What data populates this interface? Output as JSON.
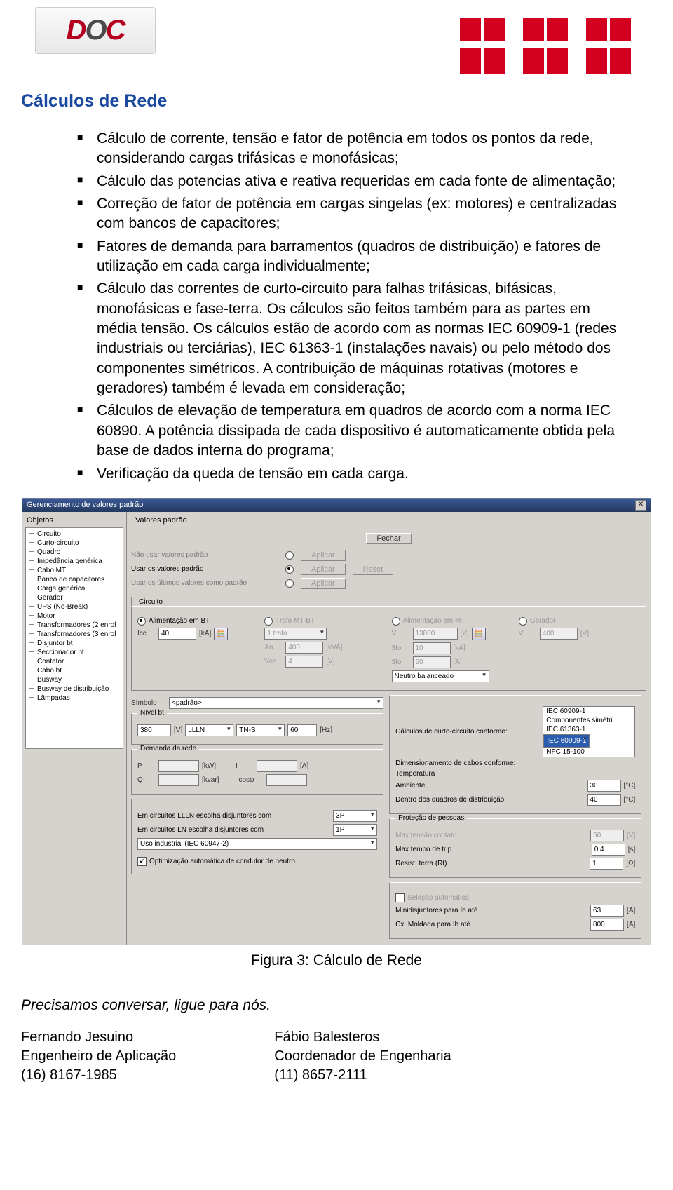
{
  "header": {
    "doc_logo_text": "DOC",
    "abb_logo_alt": "ABB"
  },
  "section_title": "Cálculos de Rede",
  "bullets": [
    "Cálculo de corrente, tensão e fator de potência em todos os pontos da rede, considerando cargas trifásicas e monofásicas;",
    "Cálculo das potencias ativa e reativa requeridas em cada fonte de alimentação;",
    "Correção de fator de potência em cargas singelas (ex: motores) e centralizadas com bancos de capacitores;",
    "Fatores de demanda para barramentos (quadros de distribuição) e fatores de utilização em cada carga individualmente;",
    "Cálculo das correntes de curto-circuito para falhas trifásicas, bifásicas, monofásicas e fase-terra. Os cálculos são feitos também para as partes em média tensão. Os cálculos estão de acordo com as normas IEC 60909-1 (redes industriais ou terciárias), IEC 61363-1 (instalações navais) ou pelo método dos componentes simétricos. A contribuição de máquinas rotativas (motores e geradores) também é levada em consideração;",
    "Cálculos de elevação de temperatura em quadros de acordo com a norma IEC 60890. A potência dissipada de cada dispositivo é automaticamente obtida pela base de dados interna do programa;",
    "Verificação da queda de tensão em cada carga."
  ],
  "dialog": {
    "title": "Gerenciamento de valores padrão",
    "close_label": "Fechar",
    "objects_header": "Objetos",
    "values_header": "Valores padrão",
    "tree_items": [
      "Circuito",
      "Curto-circuito",
      "Quadro",
      "Impedância genérica",
      "Cabo MT",
      "Banco de capacitores",
      "Carga genérica",
      "Gerador",
      "UPS (No-Break)",
      "Motor",
      "Transformadores (2 enrol",
      "Transformadores (3 enrol",
      "Disjuntor bt",
      "Seccionador bt",
      "Contator",
      "Cabo bt",
      "Busway",
      "Busway de distribuição",
      "Lâmpadas"
    ],
    "radio_options": {
      "opt1": "Não usar valores padrão",
      "opt2": "Usar os valores padrão",
      "opt3": "Usar os últimos valores como padrão"
    },
    "apply_label": "Aplicar",
    "reset_label": "Reset",
    "circuit_tab": "Circuito",
    "supply_modes": {
      "bt": "Alimentação em BT",
      "trafo": "Trafo MT-BT",
      "mt": "Alimentação em MT",
      "ger": "Gerador"
    },
    "fields": {
      "icc_label": "Icc",
      "icc_val": "40",
      "icc_unit": "[kA]",
      "trafo_sel": "1 trafo",
      "an_label": "An",
      "an_val": "400",
      "an_unit": "[kVA]",
      "vcc_label": "Vcc",
      "vcc_val": "4",
      "vcc_unit": "[V]",
      "v_label": "V",
      "v_val": "13800",
      "v_unit": "[V]",
      "tlo_label": "3Io",
      "tlo_val": "10",
      "tlo_unit": "[kA]",
      "slo_label": "3Io",
      "slo_val": "50",
      "slo_unit": "[A]",
      "neutro": "Neutro balanceado",
      "ger_v_label": "V",
      "ger_v_val": "400",
      "ger_v_unit": "[V]"
    },
    "simbolo_label": "Símbolo",
    "simbolo_val": "<padrão>",
    "nivel_legend": "Nível bt",
    "nivel_v": "380",
    "nivel_v_unit": "[V]",
    "nivel_llln": "LLLN",
    "nivel_tns": "TN-S",
    "nivel_hz": "60",
    "nivel_hz_unit": "[Hz]",
    "demanda_legend": "Demanda da rede",
    "p_label": "P",
    "p_unit": "[kW]",
    "q_label": "Q",
    "q_unit": "[kvar]",
    "i_label": "I",
    "i_unit": "[A]",
    "cosphi_label": "cosφ",
    "llln_label": "Em circuitos LLLN escolha disjuntores com",
    "llln_val": "3P",
    "ln_label": "Em circuitos LN escolha disjuntores com",
    "ln_val": "1P",
    "uso_val": "Uso industrial (IEC 60947-2)",
    "opt_neutro": "Optimização automática de condutor de neutro",
    "cc_conf_label": "Cálculos de curto-circuito conforme:",
    "cc_list": [
      "IEC 60909-1",
      "Componentes simétri",
      "IEC 61363-1",
      "IEC 60909-1",
      "NFC 15-100"
    ],
    "dim_label": "Dimensionamento de cabos conforme:",
    "temp_label": "Temperatura",
    "amb_label": "Ambiente",
    "amb_val": "30",
    "amb_unit": "[°C]",
    "quad_label": "Dentro dos quadros de distribuição",
    "quad_val": "40",
    "quad_unit": "[°C]",
    "protecao_legend": "Proteção de pessoas",
    "maxv_label": "Max tensão contato",
    "maxv_val": "50",
    "maxv_unit": "[V]",
    "maxt_label": "Max tempo de trip",
    "maxt_val": "0.4",
    "maxt_unit": "[s]",
    "rt_label": "Resist. terra (Rt)",
    "rt_val": "1",
    "rt_unit": "[Ω]",
    "selauto_label": "Seleção automática",
    "mini_label": "Minidisjuntores para Ib até",
    "mini_val": "63",
    "mini_unit": "[A]",
    "mold_label": "Cx. Moldada para Ib até",
    "mold_val": "800",
    "mold_unit": "[A]"
  },
  "figure_caption": "Figura 3: Cálculo de Rede",
  "closing": "Precisamos conversar, ligue para nós.",
  "contacts": {
    "left": {
      "name": "Fernando Jesuino",
      "role": "Engenheiro de Aplicação",
      "phone": "(16) 8167-1985"
    },
    "right": {
      "name": "Fábio Balesteros",
      "role": "Coordenador de Engenharia",
      "phone": "(11) 8657-2111"
    }
  }
}
